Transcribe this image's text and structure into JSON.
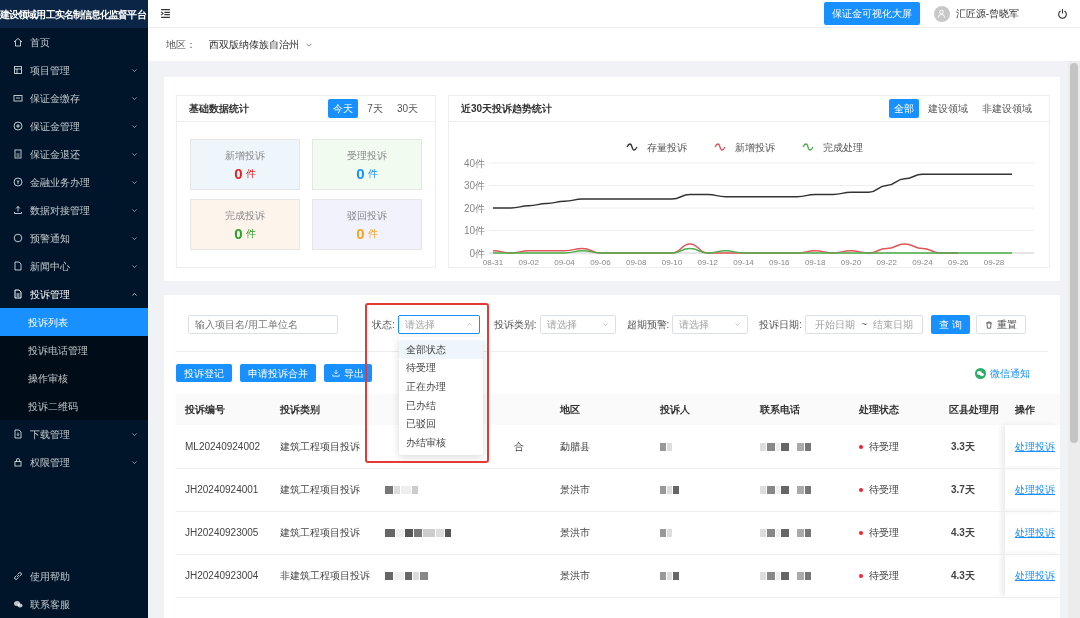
{
  "sidebar": {
    "title": "建设领域用工实名制信息化监督平台",
    "items": [
      {
        "label": "首页",
        "kind": "link"
      },
      {
        "label": "项目管理",
        "kind": "group",
        "expanded": false
      },
      {
        "label": "保证金缴存",
        "kind": "group",
        "expanded": false
      },
      {
        "label": "保证金管理",
        "kind": "group",
        "expanded": false
      },
      {
        "label": "保证金退还",
        "kind": "group",
        "expanded": false
      },
      {
        "label": "金融业务办理",
        "kind": "group",
        "expanded": false
      },
      {
        "label": "数据对接管理",
        "kind": "group",
        "expanded": false
      },
      {
        "label": "预警通知",
        "kind": "group",
        "expanded": false
      },
      {
        "label": "新闻中心",
        "kind": "group",
        "expanded": false
      },
      {
        "label": "投诉管理",
        "kind": "group",
        "expanded": true,
        "children": [
          {
            "label": "投诉列表",
            "selected": true
          },
          {
            "label": "投诉电话管理",
            "selected": false
          },
          {
            "label": "操作审核",
            "selected": false
          },
          {
            "label": "投诉二维码",
            "selected": false
          }
        ]
      },
      {
        "label": "下载管理",
        "kind": "group",
        "expanded": false
      },
      {
        "label": "权限管理",
        "kind": "group",
        "expanded": false
      }
    ],
    "footer_items": [
      {
        "label": "使用帮助"
      },
      {
        "label": "联系客服"
      }
    ]
  },
  "header": {
    "screen_button": "保证金可视化大屏",
    "user": "汇匠源-曾晓军"
  },
  "region": {
    "label": "地区：",
    "value": "西双版纳傣族自治州"
  },
  "basic_stats": {
    "title": "基础数据统计",
    "periods": [
      {
        "label": "今天",
        "selected": true
      },
      {
        "label": "7天",
        "selected": false
      },
      {
        "label": "30天",
        "selected": false
      }
    ],
    "tiles": [
      {
        "label": "新增投诉",
        "value": "0",
        "unit": "件",
        "color": "#e02424"
      },
      {
        "label": "受理投诉",
        "value": "0",
        "unit": "件",
        "color": "#1890ff"
      },
      {
        "label": "完成投诉",
        "value": "0",
        "unit": "件",
        "color": "#2ca02c"
      },
      {
        "label": "驳回投诉",
        "value": "0",
        "unit": "件",
        "color": "#f5a623"
      }
    ]
  },
  "trend": {
    "title": "近30天投诉趋势统计",
    "scopes": [
      {
        "label": "全部",
        "selected": true
      },
      {
        "label": "建设领域",
        "selected": false
      },
      {
        "label": "非建设领域",
        "selected": false
      }
    ],
    "chart_data": {
      "type": "line",
      "categories": [
        "08-31",
        null,
        "09-02",
        null,
        "09-04",
        null,
        "09-06",
        null,
        "09-08",
        null,
        "09-10",
        null,
        "09-12",
        null,
        "09-14",
        null,
        "09-16",
        null,
        "09-18",
        null,
        "09-20",
        null,
        "09-22",
        null,
        "09-24",
        null,
        "09-26",
        null,
        "09-28",
        null
      ],
      "grid": true,
      "legend": "top",
      "series": [
        {
          "name": "存量投诉",
          "color": "#333333",
          "values": [
            20,
            20,
            21,
            22,
            23,
            24,
            24,
            24,
            24,
            24,
            24,
            26,
            26,
            25,
            25,
            25,
            25,
            25,
            26,
            26,
            27,
            27,
            30,
            33,
            35,
            35,
            35,
            35,
            35,
            35
          ]
        },
        {
          "name": "新增投诉",
          "color": "#e05555",
          "values": [
            1,
            0,
            1,
            1,
            1,
            2,
            0,
            0,
            0,
            0,
            0,
            4,
            0,
            0,
            0,
            0,
            0,
            0,
            1,
            0,
            1,
            0,
            2,
            4,
            2,
            0,
            0,
            null,
            null,
            null
          ]
        },
        {
          "name": "完成处理",
          "color": "#4cae4c",
          "values": [
            0,
            0,
            0,
            0,
            0,
            1,
            0,
            0,
            0,
            0,
            0,
            2,
            0,
            1,
            0,
            0,
            0,
            0,
            0,
            0,
            0,
            0,
            0,
            0,
            0,
            0,
            0,
            0,
            0,
            0
          ]
        }
      ],
      "ylim": [
        0,
        40
      ],
      "yticks": [
        {
          "value": 0,
          "label": "0件"
        },
        {
          "value": 10,
          "label": "10件"
        },
        {
          "value": 20,
          "label": "20件"
        },
        {
          "value": 30,
          "label": "30件"
        },
        {
          "value": 40,
          "label": "40件"
        }
      ]
    }
  },
  "filters": {
    "keyword": {
      "placeholder": "输入项目名/用工单位名"
    },
    "status": {
      "label": "状态:",
      "placeholder": "请选择",
      "expanded": true,
      "options": [
        {
          "label": "全部状态",
          "selected": true
        },
        {
          "label": "待受理",
          "selected": false
        },
        {
          "label": "正在办理",
          "selected": false
        },
        {
          "label": "已办结",
          "selected": false
        },
        {
          "label": "已驳回",
          "selected": false
        },
        {
          "label": "办结审核",
          "selected": false
        }
      ]
    },
    "category": {
      "label": "投诉类别:",
      "placeholder": "请选择"
    },
    "overdue": {
      "label": "超期预警:",
      "placeholder": "请选择"
    },
    "date": {
      "label": "投诉日期:",
      "start_placeholder": "开始日期",
      "separator": "~",
      "end_placeholder": "结束日期"
    },
    "search_button": "查 询",
    "reset_button": "重置"
  },
  "actions": [
    "投诉登记",
    "申请投诉合并",
    "导出"
  ],
  "notify": "微信通知",
  "table": {
    "columns": [
      {
        "label": "投诉编号"
      },
      {
        "label": "投诉类别"
      },
      {},
      {
        "label": "地区"
      },
      {
        "label": "投诉人"
      },
      {
        "label": "联系电话"
      },
      {
        "label": "处理状态"
      },
      {
        "label": "区县处理用"
      },
      {
        "label": "操作"
      }
    ],
    "rows": [
      {
        "id": "ML20240924002",
        "type": "建筑工程项目投诉",
        "project_fragment": "合",
        "region": "勐腊县",
        "redacted": true,
        "status": "待受理",
        "color": "#f5222d",
        "days": "3.3天",
        "action": "处理投诉"
      },
      {
        "id": "JH20240924001",
        "type": "建筑工程项目投诉",
        "region": "景洪市",
        "redacted": true,
        "status": "待受理",
        "color": "#f5222d",
        "days": "3.7天",
        "action": "处理投诉"
      },
      {
        "id": "JH20240923005",
        "type": "建筑工程项目投诉",
        "region": "景洪市",
        "redacted": true,
        "status": "待受理",
        "color": "#f5222d",
        "days": "4.3天",
        "action": "处理投诉"
      },
      {
        "id": "JH20240923004",
        "type": "非建筑工程项目投诉",
        "region": "景洪市",
        "redacted": true,
        "status": "待受理",
        "color": "#f5222d",
        "days": "4.3天",
        "action": "处理投诉"
      }
    ]
  }
}
